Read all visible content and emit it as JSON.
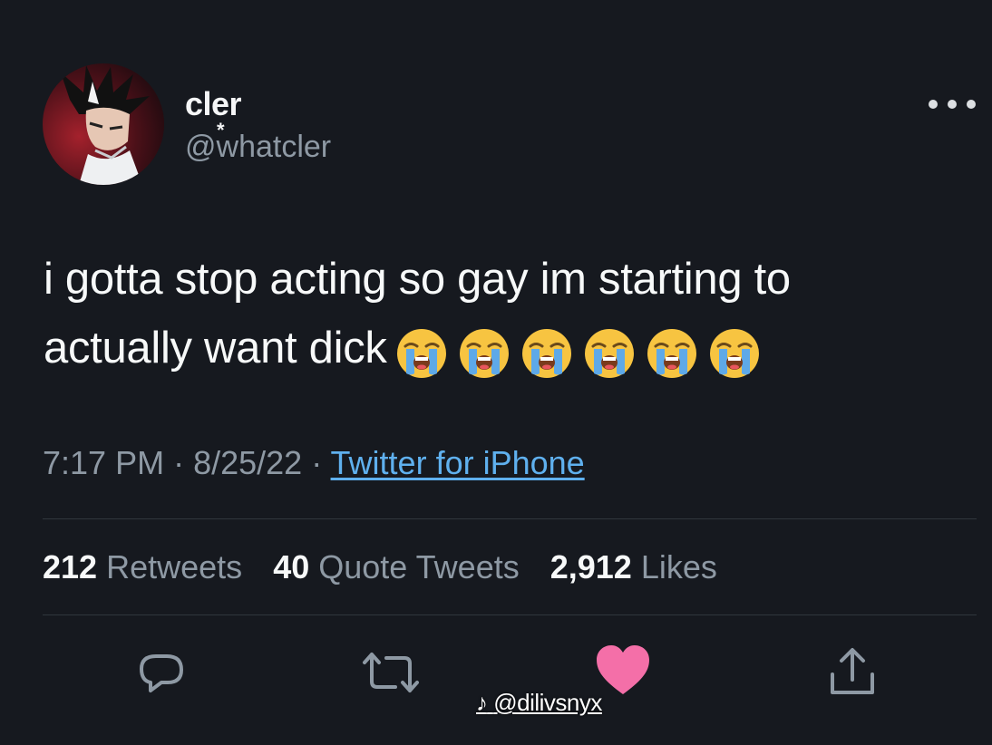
{
  "tweet": {
    "display_name": "cler",
    "name_decoration": "*",
    "handle": "@whatcler",
    "text_line1": "i gotta stop acting so gay im starting to",
    "text_line2": "actually want dick",
    "emoji": "loudly-crying-face",
    "emoji_count": 6,
    "time": "7:17 PM",
    "separator1": " · ",
    "date": "8/25/22",
    "separator2": " · ",
    "source": "Twitter for iPhone"
  },
  "stats": {
    "retweets_count": "212",
    "retweets_label": "Retweets",
    "quotes_count": "40",
    "quotes_label": "Quote Tweets",
    "likes_count": "2,912",
    "likes_label": "Likes"
  },
  "actions": {
    "reply_icon": "speech-bubble-icon",
    "retweet_icon": "retweet-arrows-icon",
    "like_icon": "heart-icon",
    "share_icon": "share-upload-icon"
  },
  "watermark": {
    "text": "@dilivsnyx"
  },
  "colors": {
    "background": "#16191f",
    "text_primary": "#f7f9f9",
    "text_secondary": "#8e99a4",
    "link": "#5fb0ee",
    "like_active": "#f46fa8",
    "divider": "#30363d"
  }
}
